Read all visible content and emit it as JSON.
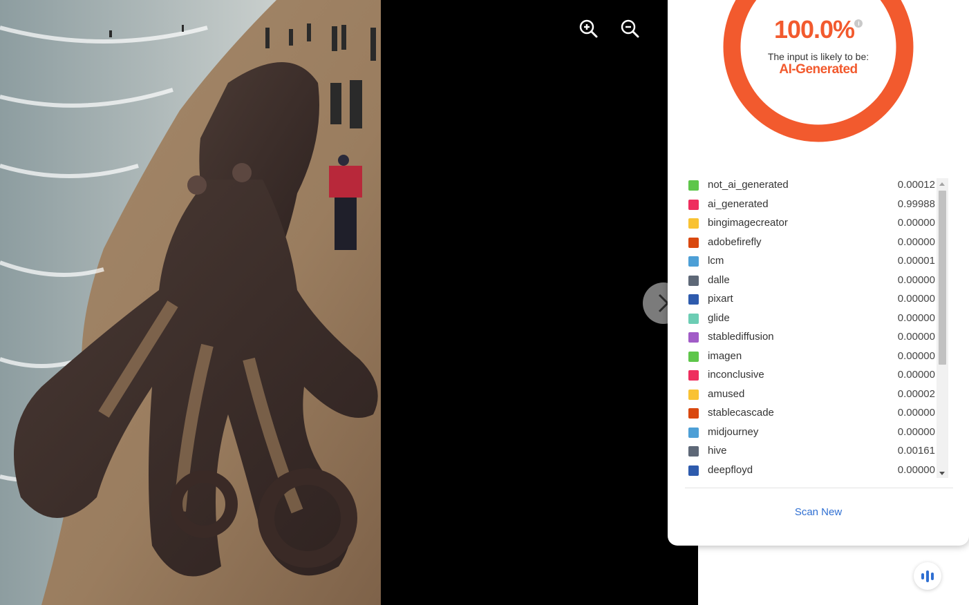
{
  "viewer": {
    "image_alt": "",
    "zoom_in_icon": "zoom-in-icon",
    "zoom_out_icon": "zoom-out-icon",
    "next_icon": "chevron-right-icon"
  },
  "result": {
    "percentage": "100.0%",
    "likely_label": "The input is likely to be:",
    "verdict": "AI-Generated",
    "accent_color": "#f25a2e",
    "scan_new_label": "Scan New"
  },
  "classes": [
    {
      "label": "not_ai_generated",
      "value": "0.00012",
      "color": "#5ec64a"
    },
    {
      "label": "ai_generated",
      "value": "0.99988",
      "color": "#ee2e5e"
    },
    {
      "label": "bingimagecreator",
      "value": "0.00000",
      "color": "#f9c233"
    },
    {
      "label": "adobefirefly",
      "value": "0.00000",
      "color": "#d9480f"
    },
    {
      "label": "lcm",
      "value": "0.00001",
      "color": "#4d9fd6"
    },
    {
      "label": "dalle",
      "value": "0.00000",
      "color": "#5e6877"
    },
    {
      "label": "pixart",
      "value": "0.00000",
      "color": "#2e5bad"
    },
    {
      "label": "glide",
      "value": "0.00000",
      "color": "#6ccdb4"
    },
    {
      "label": "stablediffusion",
      "value": "0.00000",
      "color": "#a15cc7"
    },
    {
      "label": "imagen",
      "value": "0.00000",
      "color": "#5ec64a"
    },
    {
      "label": "inconclusive",
      "value": "0.00000",
      "color": "#ee2e5e"
    },
    {
      "label": "amused",
      "value": "0.00002",
      "color": "#f9c233"
    },
    {
      "label": "stablecascade",
      "value": "0.00000",
      "color": "#d9480f"
    },
    {
      "label": "midjourney",
      "value": "0.00000",
      "color": "#4d9fd6"
    },
    {
      "label": "hive",
      "value": "0.00161",
      "color": "#5e6877"
    },
    {
      "label": "deepfloyd",
      "value": "0.00000",
      "color": "#2e5bad"
    }
  ],
  "voice_icon": "audio-bars-icon"
}
